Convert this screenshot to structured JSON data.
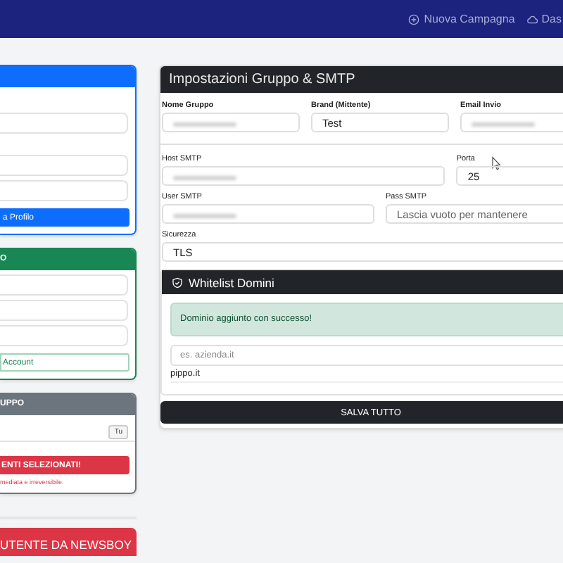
{
  "navbar": {
    "links": [
      {
        "label": "Nuova Campagna"
      },
      {
        "label": "Das"
      }
    ]
  },
  "left_cards": [
    {
      "kind": "profile",
      "color": "#0d6efd",
      "fields": [
        {
          "kind": "input"
        },
        {
          "kind": "input"
        },
        {
          "kind": "input"
        }
      ],
      "button": {
        "label": "a Profilo",
        "kind": "solid"
      }
    },
    {
      "color": "#198754",
      "title": "O",
      "fields": [
        {
          "kind": "input"
        },
        {
          "kind": "input"
        },
        {
          "kind": "input"
        }
      ],
      "button": {
        "label": "Account",
        "kind": "outline"
      }
    },
    {
      "color": "#6c757d",
      "title": "UPPO",
      "badge": "Tu",
      "button": {
        "label": "ENTI SELEZIONATI!",
        "kind": "danger"
      },
      "note": "mediata e irreversibile."
    }
  ],
  "left_footer_button": "UTENTE DA NEWSBOY",
  "settings": {
    "title": "Impostazioni Gruppo & SMTP",
    "rows": [
      [
        {
          "label": "Nome Gruppo",
          "kind": "blurred"
        },
        {
          "label": "Brand (Mittente)",
          "kind": "value",
          "value": "Test"
        },
        {
          "label": "Email Invio",
          "kind": "blurred"
        }
      ],
      [
        {
          "label": "Host SMTP",
          "kind": "blurred"
        },
        {
          "label": "Porta",
          "kind": "value",
          "value": "25"
        }
      ],
      [
        {
          "label": "User SMTP",
          "kind": "blurred"
        },
        {
          "label": "Pass SMTP",
          "kind": "placeholder",
          "placeholder": "Lascia vuoto per mantenere"
        }
      ],
      [
        {
          "label": "Sicurezza",
          "kind": "value",
          "value": "TLS"
        }
      ]
    ],
    "whitelist": {
      "title": "Whitelist Domini",
      "alert": "Dominio aggiunto con successo!",
      "input_placeholder": "es. azienda.it",
      "domains": [
        "pippo.it"
      ]
    },
    "save_button": "SALVA TUTTO"
  }
}
